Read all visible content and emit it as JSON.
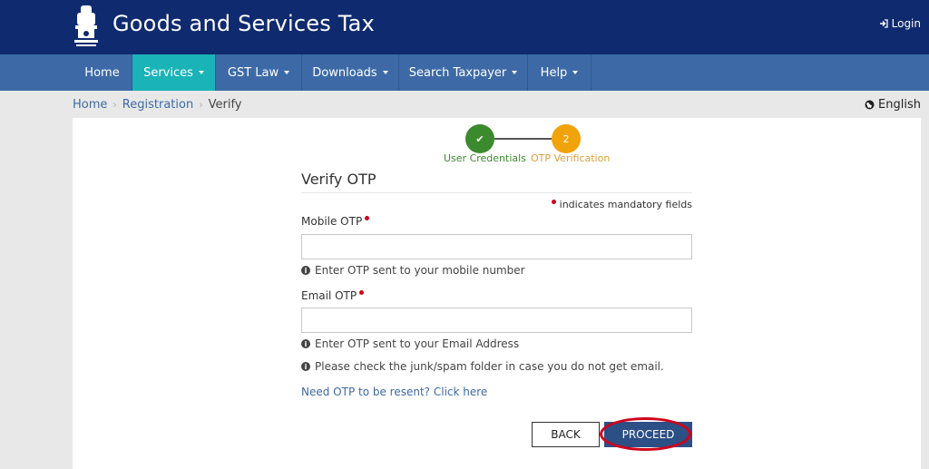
{
  "header": {
    "site_title": "Goods and Services Tax",
    "login_label": "Login",
    "emblem_icon": "national-emblem-icon",
    "login_icon": "sign-in-icon"
  },
  "nav": {
    "items": [
      {
        "label": "Home",
        "has_dropdown": false
      },
      {
        "label": "Services",
        "has_dropdown": true,
        "active": true
      },
      {
        "label": "GST Law",
        "has_dropdown": true
      },
      {
        "label": "Downloads",
        "has_dropdown": true
      },
      {
        "label": "Search Taxpayer",
        "has_dropdown": true
      },
      {
        "label": "Help",
        "has_dropdown": true
      }
    ]
  },
  "breadcrumb": {
    "items": [
      "Home",
      "Registration",
      "Verify"
    ]
  },
  "language": {
    "label": "English",
    "icon": "globe-icon"
  },
  "stepper": {
    "steps": [
      {
        "number": "✔",
        "label": "User Credentials",
        "status": "complete"
      },
      {
        "number": "2",
        "label": "OTP Verification",
        "status": "current"
      }
    ]
  },
  "form": {
    "title": "Verify OTP",
    "mandatory_note": "indicates mandatory fields",
    "mobile_otp": {
      "label": "Mobile OTP",
      "value": "",
      "hint": "Enter OTP sent to your mobile number"
    },
    "email_otp": {
      "label": "Email OTP",
      "value": "",
      "hint": "Enter OTP sent to your Email Address"
    },
    "spam_hint": "Please check the junk/spam folder in case you do not get email.",
    "resend_link": "Need OTP to be resent? Click here",
    "back_label": "BACK",
    "proceed_label": "PROCEED"
  },
  "colors": {
    "header_bg": "#0f2a6e",
    "nav_bg": "#3d6aa6",
    "nav_active": "#1ab3b8",
    "step_complete": "#3c8a2e",
    "step_current": "#f0a30a",
    "required": "#d0021b",
    "proceed_bg": "#2c4f86"
  }
}
